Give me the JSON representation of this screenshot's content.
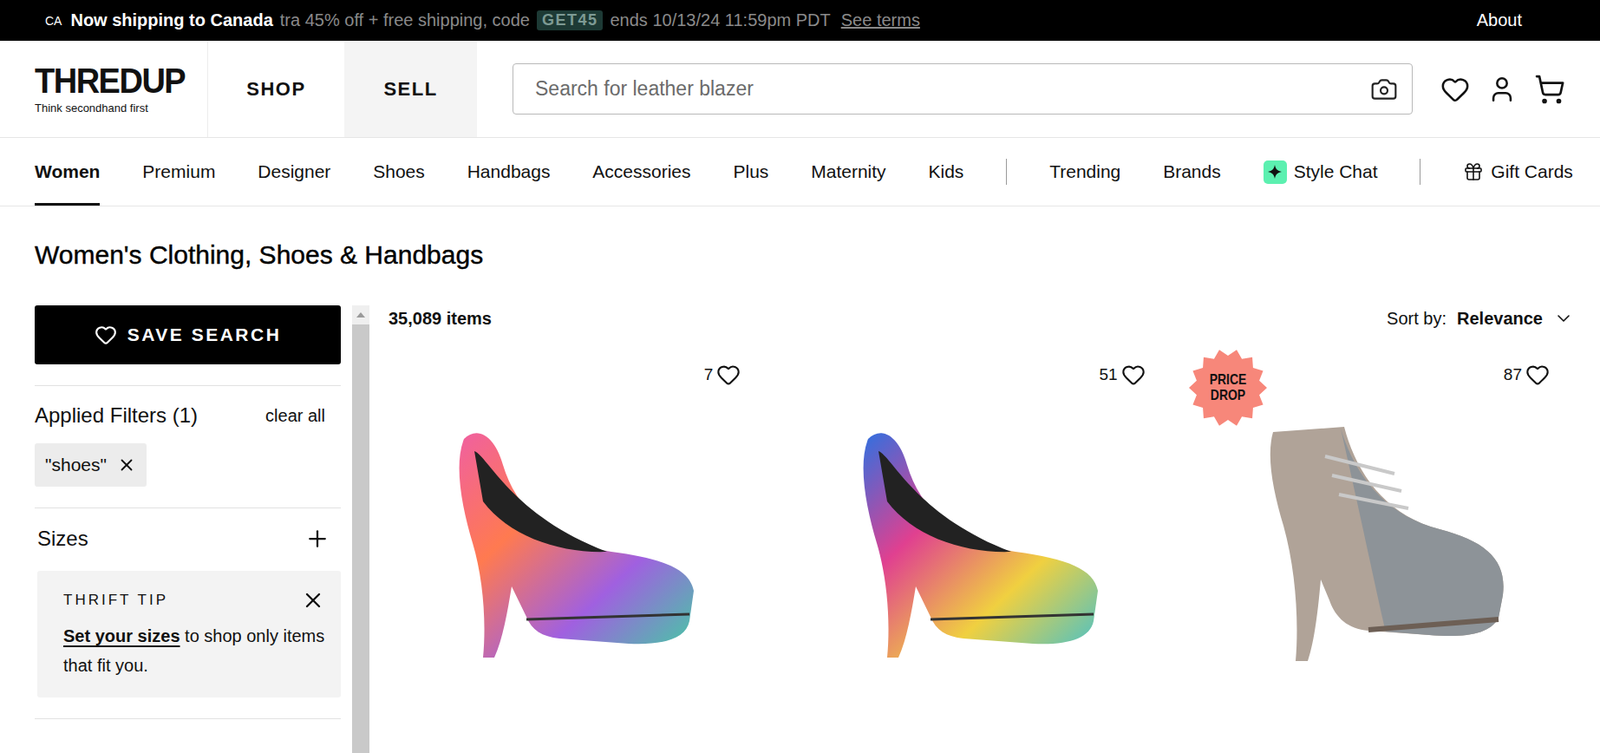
{
  "topBar": {
    "region": "CA",
    "shipping": "Now shipping to Canada",
    "promo": "tra 45% off + free shipping, code",
    "code": "GET45",
    "promoEnd": "ends 10/13/24 11:59pm PDT",
    "terms": "See terms",
    "about": "About"
  },
  "header": {
    "logo": "THREDUP",
    "tagline": "Think secondhand first",
    "tabs": [
      {
        "label": "SHOP",
        "selected": true
      },
      {
        "label": "SELL",
        "selected": false
      }
    ],
    "search": {
      "placeholder": "Search for leather blazer"
    }
  },
  "nav": {
    "categories": [
      {
        "label": "Women",
        "selected": true
      },
      {
        "label": "Premium",
        "selected": false
      },
      {
        "label": "Designer",
        "selected": false
      },
      {
        "label": "Shoes",
        "selected": false
      },
      {
        "label": "Handbags",
        "selected": false
      },
      {
        "label": "Accessories",
        "selected": false
      },
      {
        "label": "Plus",
        "selected": false
      },
      {
        "label": "Maternity",
        "selected": false
      },
      {
        "label": "Kids",
        "selected": false
      }
    ],
    "links": [
      {
        "label": "Trending",
        "kind": "text"
      },
      {
        "label": "Brands",
        "kind": "text"
      },
      {
        "label": "Style Chat",
        "kind": "ai"
      }
    ],
    "giftCards": "Gift Cards"
  },
  "page": {
    "title": "Women's Clothing, Shoes & Handbags"
  },
  "sidebar": {
    "saveSearch": "SAVE SEARCH",
    "appliedTitle": "Applied Filters (1)",
    "clearAll": "clear all",
    "chips": [
      {
        "label": "\"shoes\""
      }
    ],
    "sections": [
      {
        "label": "Sizes",
        "expanded": false
      }
    ],
    "tip": {
      "title": "THRIFT TIP",
      "link": "Set your sizes",
      "text": " to shop only items that fit you."
    }
  },
  "results": {
    "count": "35,089 items",
    "sortLabel": "Sort by:",
    "sortValue": "Relevance",
    "products": [
      {
        "likes": "7",
        "liked": false,
        "kind": "pump"
      },
      {
        "likes": "51",
        "liked": false,
        "kind": "peep-toe"
      },
      {
        "likes": "87",
        "liked": false,
        "kind": "bootie",
        "badge": "PRICE DROP"
      }
    ]
  }
}
